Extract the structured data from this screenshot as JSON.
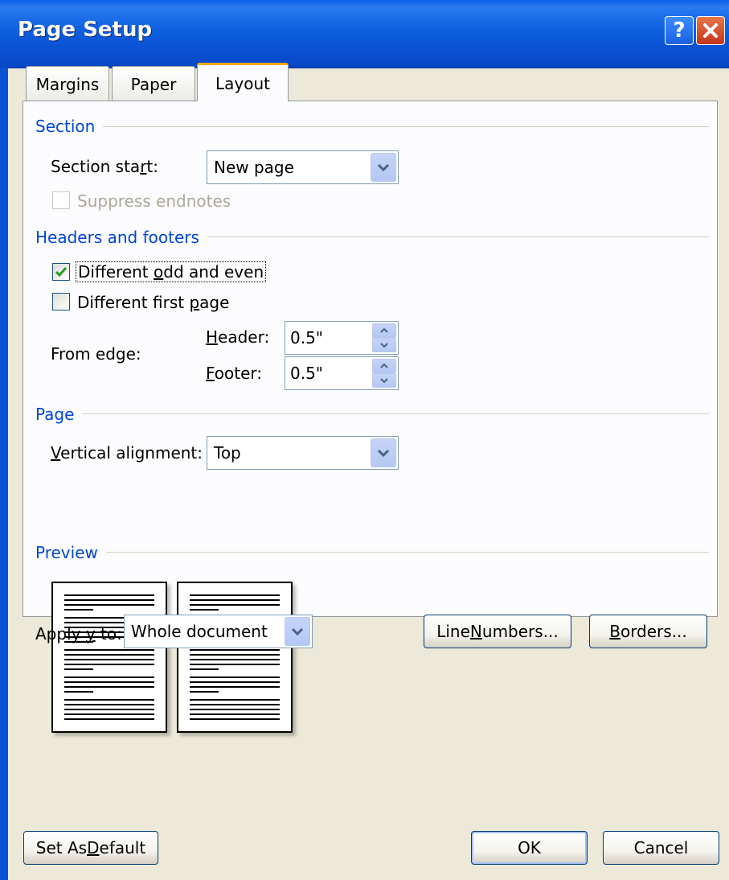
{
  "window": {
    "title": "Page Setup"
  },
  "tabs": [
    {
      "label": "Margins"
    },
    {
      "label": "Paper"
    },
    {
      "label": "Layout"
    }
  ],
  "section": {
    "heading": "Section",
    "start_label_pre": "Section sta",
    "start_label_u": "r",
    "start_label_post": "t:",
    "start_value": "New page",
    "suppress_endnotes_label": "Suppress endnotes",
    "suppress_endnotes_checked": false
  },
  "headers_footers": {
    "heading": "Headers and footers",
    "odd_even_pre": "Different ",
    "odd_even_u": "o",
    "odd_even_post": "dd and even",
    "odd_even_checked": true,
    "first_page_pre": "Different first ",
    "first_page_u": "p",
    "first_page_post": "age",
    "first_page_checked": false,
    "from_edge_label": "From edge:",
    "header_label_u": "H",
    "header_label_post": "eader:",
    "header_value": "0.5\"",
    "footer_label_u": "F",
    "footer_label_post": "ooter:",
    "footer_value": "0.5\""
  },
  "page": {
    "heading": "Page",
    "valign_label_u": "V",
    "valign_label_post": "ertical alignment:",
    "valign_value": "Top"
  },
  "preview": {
    "heading": "Preview"
  },
  "apply": {
    "label_pre": "Apply ",
    "label_u": "y",
    "label_post": "o:",
    "label_mid": "",
    "value": "Whole document"
  },
  "buttons": {
    "line_numbers_pre": "Line ",
    "line_numbers_u": "N",
    "line_numbers_post": "umbers...",
    "borders_u": "B",
    "borders_post": "orders...",
    "set_default_pre": "Set As ",
    "set_default_u": "D",
    "set_default_post": "efault",
    "ok": "OK",
    "cancel": "Cancel"
  },
  "colors": {
    "titlebar": "#0A52D4",
    "group_heading": "#0046D5",
    "tab_highlight": "#F5A80E",
    "dialog_bg": "#ECE9D8"
  }
}
